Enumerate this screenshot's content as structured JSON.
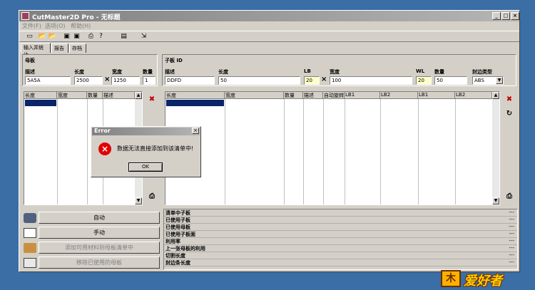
{
  "window": {
    "title": "CutMaster2D Pro - 无标题",
    "min": "_",
    "max": "□",
    "close": "×"
  },
  "menu": [
    "文件(F)",
    "选项(O)",
    "帮助(H)"
  ],
  "tabs": [
    "输入并统计",
    "报告",
    "存档"
  ],
  "mother": {
    "heading": "母板",
    "labels": {
      "desc": "描述",
      "length": "长度",
      "width": "宽度",
      "qty": "数量"
    },
    "values": {
      "desc": "5A5A",
      "length": "2500",
      "width": "1250",
      "qty": "1"
    },
    "grid_headers": [
      "长度",
      "宽度",
      "数量",
      "描述"
    ]
  },
  "child": {
    "heading": "子板 ID",
    "labels": {
      "desc": "描述",
      "length": "长度",
      "lb": "LB",
      "width": "宽度",
      "wl": "WL",
      "qty": "数量",
      "edge": "封边类型"
    },
    "values": {
      "desc": "DDFD",
      "length": "50",
      "lb": "20",
      "width": "100",
      "wl": "20",
      "qty": "50",
      "edge": "ABS"
    },
    "grid_headers": [
      "长度",
      "宽度",
      "数量",
      "描述",
      "自动旋转",
      "LB1",
      "LB2",
      "LB1",
      "LB2"
    ]
  },
  "actions": [
    "自动",
    "手动",
    "添加可用材料到母板清单中",
    "移除已使用的母板"
  ],
  "stats": [
    "清单中子板",
    "已使用子板",
    "已使用母板",
    "已使用子板面",
    "利用率",
    "上一张母板的利用",
    "切割长度",
    "封边条长度"
  ],
  "stat_value": "---",
  "dialog": {
    "title": "Error",
    "message": "数据无法直接添加到该清单中!",
    "ok": "OK",
    "icon": "error-icon"
  },
  "watermark": {
    "mark": "木",
    "text": "爱好者"
  }
}
